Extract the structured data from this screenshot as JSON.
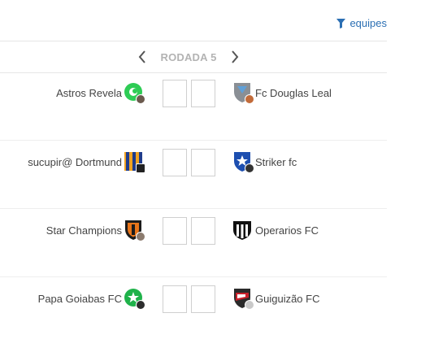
{
  "header": {
    "filter_label": "equipes",
    "filter_icon": "funnel-icon",
    "accent_color": "#2b6fb3"
  },
  "round": {
    "label": "RODADA 5",
    "prev_icon": "chevron-left-icon",
    "next_icon": "chevron-right-icon"
  },
  "matches": [
    {
      "home": {
        "name": "Astros Revela",
        "badge": "green-circle-crest"
      },
      "away": {
        "name": "Fc Douglas Leal",
        "badge": "grey-shield-crest"
      },
      "home_score": "",
      "away_score": ""
    },
    {
      "home": {
        "name": "sucupir@ Dortmund",
        "badge": "blue-orange-stripes-crest"
      },
      "away": {
        "name": "Striker fc",
        "badge": "blue-white-shield-crest"
      },
      "home_score": "",
      "away_score": ""
    },
    {
      "home": {
        "name": "Star Champions",
        "badge": "orange-black-shield-crest"
      },
      "away": {
        "name": "Operarios FC",
        "badge": "black-white-stripes-crest"
      },
      "home_score": "",
      "away_score": ""
    },
    {
      "home": {
        "name": "Papa Goiabas FC",
        "badge": "green-star-crest"
      },
      "away": {
        "name": "Guiguizão FC",
        "badge": "red-black-shield-crest"
      },
      "home_score": "",
      "away_score": ""
    }
  ]
}
